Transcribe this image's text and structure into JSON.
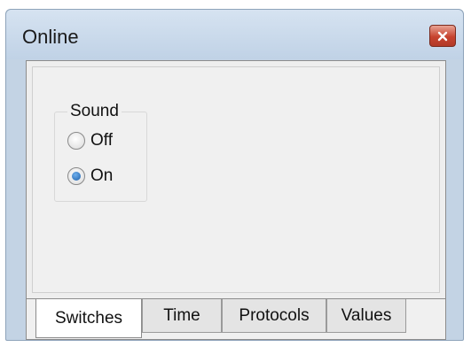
{
  "window": {
    "title": "Online"
  },
  "sound_group": {
    "label": "Sound",
    "options": [
      {
        "label": "Off",
        "checked": false
      },
      {
        "label": "On",
        "checked": true
      }
    ]
  },
  "tabs": [
    {
      "label": "Switches",
      "active": true
    },
    {
      "label": "Time",
      "active": false
    },
    {
      "label": "Protocols",
      "active": false
    },
    {
      "label": "Values",
      "active": false
    }
  ],
  "icons": {
    "close": "close-icon"
  },
  "colors": {
    "close_button": "#c7432f",
    "radio_selected": "#1d5fa8",
    "titlebar": "#c3d3e4"
  }
}
